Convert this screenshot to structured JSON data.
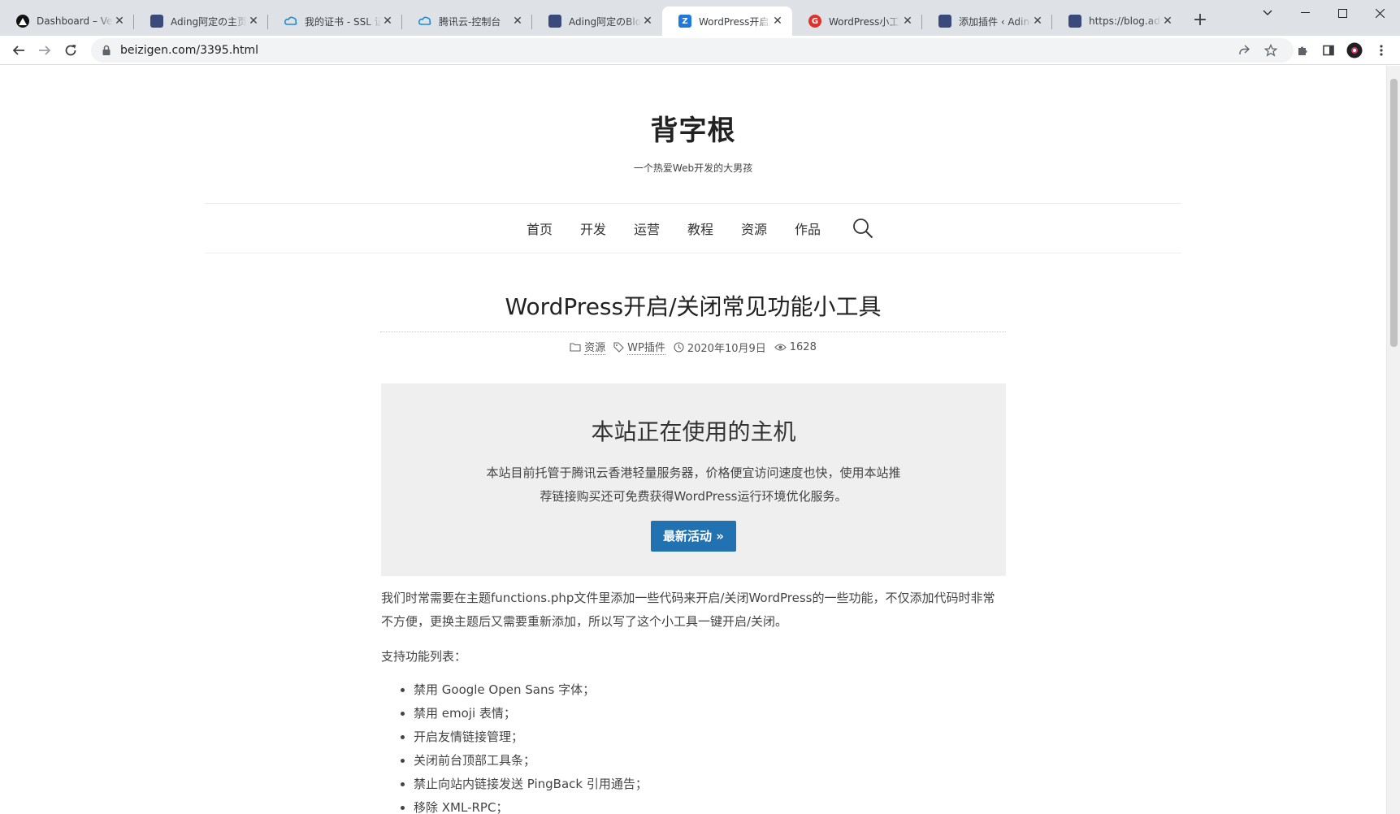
{
  "browser": {
    "tabs": [
      {
        "title": "Dashboard – Vercel",
        "favicon": "vercel-triangle-icon"
      },
      {
        "title": "Ading阿定の主页",
        "favicon": "avatar-favicon"
      },
      {
        "title": "我的证书 - SSL 证书",
        "favicon": "tencent-cloud-icon"
      },
      {
        "title": "腾讯云-控制台",
        "favicon": "tencent-cloud-icon"
      },
      {
        "title": "Ading阿定のBlog",
        "favicon": "avatar-favicon"
      },
      {
        "title": "WordPress开启/关闭",
        "favicon": "z-blue-icon"
      },
      {
        "title": "WordPress小工具",
        "favicon": "g-red-icon"
      },
      {
        "title": "添加插件 ‹ Ading阿定",
        "favicon": "avatar-favicon"
      },
      {
        "title": "https://blog.ading.",
        "favicon": "avatar-favicon"
      }
    ],
    "url": "beizigen.com/3395.html"
  },
  "site": {
    "title": "背字根",
    "tagline": "一个热爱Web开发的大男孩",
    "nav": [
      "首页",
      "开发",
      "运营",
      "教程",
      "资源",
      "作品"
    ]
  },
  "post": {
    "title": "WordPress开启/关闭常见功能小工具",
    "meta": {
      "category": "资源",
      "tag": "WP插件",
      "date": "2020年10月9日",
      "views": "1628"
    }
  },
  "promo": {
    "heading": "本站正在使用的主机",
    "body": "本站目前托管于腾讯云香港轻量服务器，价格便宜访问速度也快，使用本站推荐链接购买还可免费获得WordPress运行环境优化服务。",
    "button": "最新活动 »"
  },
  "article": {
    "intro": "我们时常需要在主题functions.php文件里添加一些代码来开启/关闭WordPress的一些功能，不仅添加代码时非常不方便，更换主题后又需要重新添加，所以写了这个小工具一键开启/关闭。",
    "list_label": "支持功能列表：",
    "features": [
      "禁用 Google Open Sans 字体；",
      "禁用 emoji 表情；",
      "开启友情链接管理；",
      "关闭前台顶部工具条；",
      "禁止向站内链接发送 PingBack 引用通告；",
      "移除 XML-RPC；"
    ]
  },
  "colors": {
    "tabstrip": "#dee1e6",
    "button": "#2271b1",
    "promo_bg": "#efefef"
  }
}
